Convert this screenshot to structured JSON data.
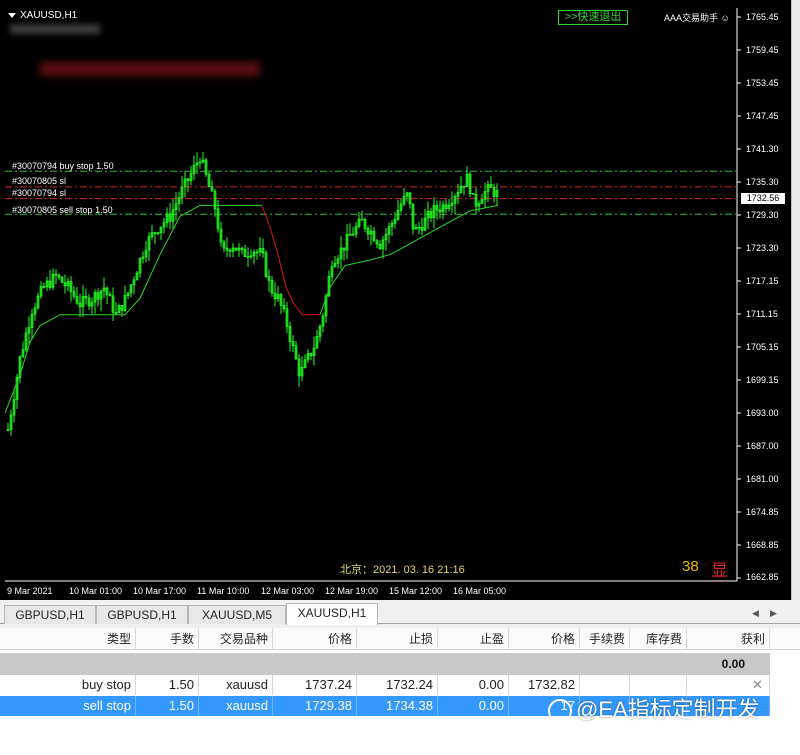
{
  "chart": {
    "title": "XAUUSD,H1",
    "quick_exit_label": ">>快速退出",
    "assistant_label": "AAA交易助手",
    "assistant_icon": "smile-icon",
    "beijing_time": "北京：2021. 03. 16  21:16",
    "count_value": "38",
    "display_label": "显",
    "current_price": "1732.56",
    "price_ticks": [
      "1765.45",
      "1759.45",
      "1753.45",
      "1747.45",
      "1741.30",
      "1735.30",
      "1729.30",
      "1723.30",
      "1717.15",
      "1711.15",
      "1705.15",
      "1699.15",
      "1693.00",
      "1687.00",
      "1681.00",
      "1674.85",
      "1668.85",
      "1662.85"
    ],
    "time_labels": [
      "9 Mar 2021",
      "10 Mar 01:00",
      "10 Mar 17:00",
      "11 Mar 10:00",
      "12 Mar 03:00",
      "12 Mar 19:00",
      "15 Mar 12:00",
      "16 Mar 05:00"
    ],
    "order_lines": [
      {
        "label": "#30070794 buy stop 1.50",
        "price": 1737.24,
        "color": "#2fbf2f"
      },
      {
        "label": "#30070805 sl",
        "price": 1734.38,
        "color": "#d22020"
      },
      {
        "label": "#30070794 sl",
        "price": 1732.24,
        "color": "#d22020"
      },
      {
        "label": "#30070805 sell stop 1.50",
        "price": 1729.38,
        "color": "#2fbf2f"
      }
    ],
    "colors": {
      "candle": "#22ff22",
      "trail_up": "#22dd22",
      "trail_down": "#dd1111",
      "background": "#000000"
    }
  },
  "tabs": [
    {
      "label": "GBPUSD,H1",
      "active": false
    },
    {
      "label": "GBPUSD,H1",
      "active": false
    },
    {
      "label": "XAUUSD,M5",
      "active": false
    },
    {
      "label": "XAUUSD,H1",
      "active": true
    }
  ],
  "table": {
    "headers": [
      "类型",
      "手数",
      "交易品种",
      "价格",
      "止损",
      "止盈",
      "价格",
      "手续费",
      "库存费",
      "获利"
    ],
    "summary_profit": "0.00",
    "rows": [
      {
        "type": "buy stop",
        "lots": "1.50",
        "symbol": "xauusd",
        "price": "1737.24",
        "sl": "1732.24",
        "tp": "0.00",
        "cur_price": "1732.82",
        "commission": "",
        "swap": "",
        "profit": ""
      },
      {
        "type": "sell stop",
        "lots": "1.50",
        "symbol": "xauusd",
        "price": "1729.38",
        "sl": "1734.38",
        "tp": "0.00",
        "cur_price": "17",
        "commission": "",
        "swap": "",
        "profit": ""
      }
    ]
  },
  "watermark": "@EA指标定制开发"
}
